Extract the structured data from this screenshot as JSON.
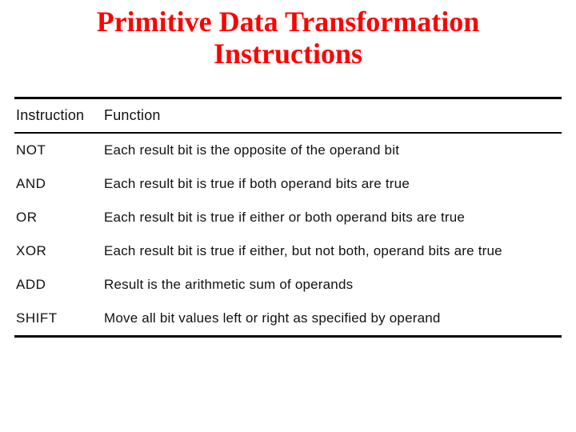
{
  "title_line1": "Primitive Data Transformation",
  "title_line2": "Instructions",
  "table": {
    "headers": {
      "instruction": "Instruction",
      "function": "Function"
    },
    "rows": [
      {
        "instruction": "NOT",
        "function": "Each result bit is the opposite of the operand bit"
      },
      {
        "instruction": "AND",
        "function": "Each result bit is true if both operand bits are true"
      },
      {
        "instruction": "OR",
        "function": "Each result bit is true if either or both operand bits are true"
      },
      {
        "instruction": "XOR",
        "function": "Each result bit is true if either, but not both, operand bits are true"
      },
      {
        "instruction": "ADD",
        "function": "Result is the arithmetic sum of operands"
      },
      {
        "instruction": "SHIFT",
        "function": "Move all bit values left or right as specified by operand"
      }
    ]
  }
}
